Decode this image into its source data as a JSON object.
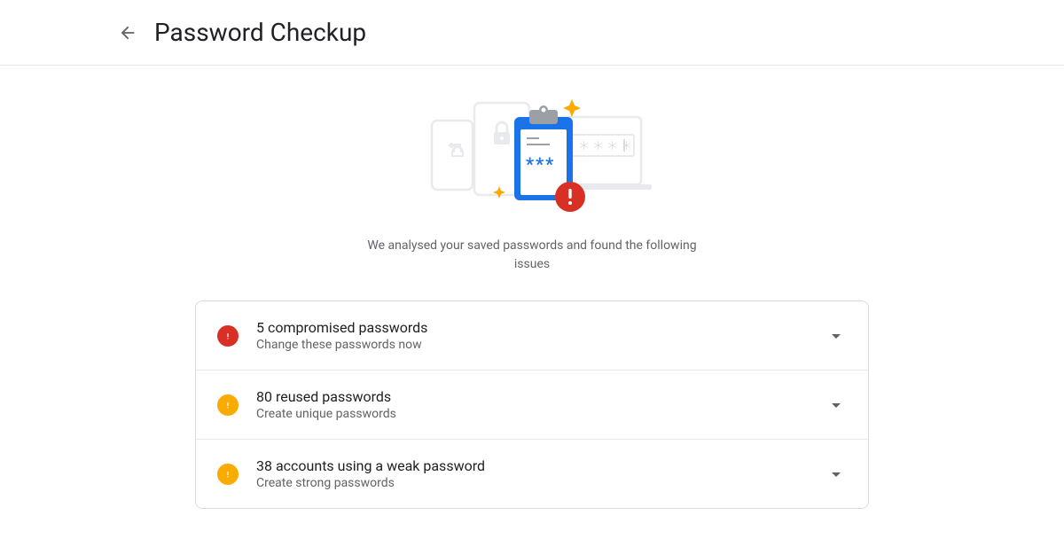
{
  "header": {
    "title": "Password Checkup"
  },
  "hero": {
    "subtitle": "We analysed your saved passwords and found the following issues"
  },
  "issues": [
    {
      "severity": "red",
      "title": "5 compromised passwords",
      "subtitle": "Change these passwords now"
    },
    {
      "severity": "yellow",
      "title": "80 reused passwords",
      "subtitle": "Create unique passwords"
    },
    {
      "severity": "yellow",
      "title": "38 accounts using a weak password",
      "subtitle": "Create strong passwords"
    }
  ],
  "colors": {
    "red": "#d93025",
    "yellow": "#f9ab00",
    "blue": "#1a73e8",
    "textPrimary": "#202124",
    "textSecondary": "#5f6368",
    "border": "#dadce0"
  }
}
